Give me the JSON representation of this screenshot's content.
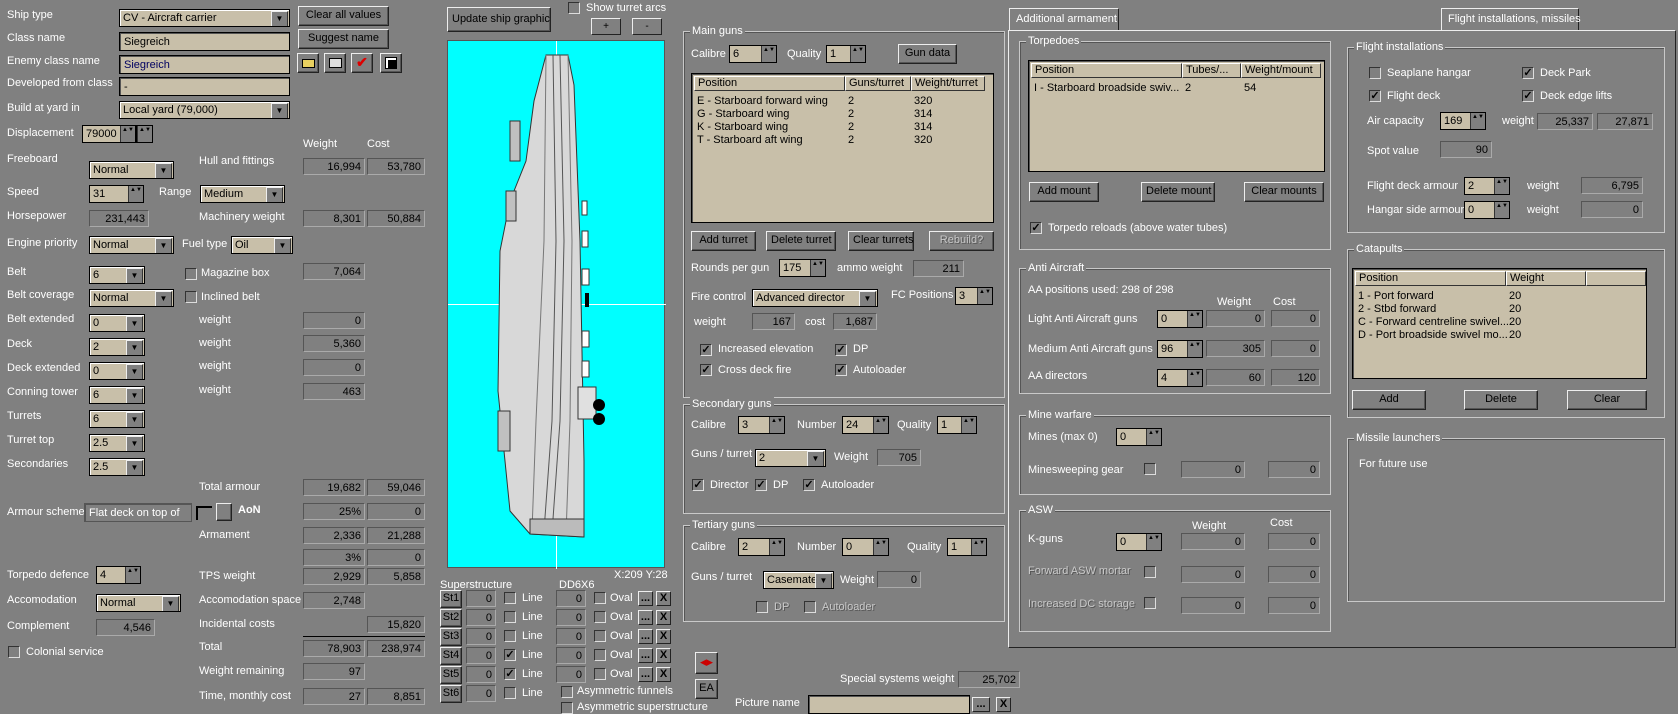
{
  "left": {
    "ship_type_label": "Ship type",
    "ship_type": "CV - Aircraft carrier",
    "class_name_label": "Class name",
    "class_name": "Siegreich",
    "enemy_class_label": "Enemy class name",
    "enemy_class": "Siegreich",
    "developed_label": "Developed from class",
    "developed": "-",
    "build_yard_label": "Build at yard in",
    "build_yard": "Local yard (79,000)",
    "clear_all": "Clear all values",
    "suggest_name": "Suggest name",
    "displacement_label": "Displacement",
    "displacement": "79000",
    "weight_header": "Weight",
    "cost_header": "Cost",
    "freeboard_label": "Freeboard",
    "freeboard": "Normal",
    "hull_label": "Hull and fittings",
    "hull_weight": "16,994",
    "hull_cost": "53,780",
    "speed_label": "Speed",
    "speed": "31",
    "range_label": "Range",
    "range": "Medium",
    "horsepower_label": "Horsepower",
    "horsepower": "231,443",
    "machinery_label": "Machinery weight",
    "machinery_weight": "8,301",
    "machinery_cost": "50,884",
    "engine_label": "Engine priority",
    "engine": "Normal",
    "fuel_label": "Fuel type",
    "fuel": "Oil",
    "belt_label": "Belt",
    "belt": "6",
    "magazine_box": "Magazine box",
    "magazine_weight": "7,064",
    "belt_cov_label": "Belt coverage",
    "belt_cov": "Normal",
    "inclined_belt": "Inclined belt",
    "belt_ext_label": "Belt extended",
    "belt_ext": "0",
    "deck_label": "Deck",
    "deck": "2",
    "deck_ext_label": "Deck extended",
    "deck_ext": "0",
    "conning_label": "Conning tower",
    "conning": "6",
    "weight_word": "weight",
    "w_belt_ext": "0",
    "w_deck": "5,360",
    "w_deck_ext": "0",
    "w_conning": "463",
    "turrets_label": "Turrets",
    "turrets": "6",
    "turret_top_label": "Turret top",
    "turret_top": "2.5",
    "secondaries_label": "Secondaries",
    "secondaries": "2.5",
    "total_armour_label": "Total armour",
    "total_armour_weight": "19,682",
    "total_armour_cost": "59,046",
    "armour_scheme_label": "Armour scheme",
    "armour_scheme": "Flat deck on top of",
    "aon": "AoN",
    "pct1": "25%",
    "pct1_cost": "0",
    "armament_label": "Armament",
    "armament_weight": "2,336",
    "armament_cost": "21,288",
    "pct2": "3%",
    "pct2_cost": "0",
    "torpedo_def_label": "Torpedo defence",
    "torpedo_def": "4",
    "tps_label": "TPS weight",
    "tps_weight": "2,929",
    "tps_cost": "5,858",
    "accom_label": "Accomodation",
    "accom": "Normal",
    "accom_space_label": "Accomodation space",
    "accom_space": "2,748",
    "complement_label": "Complement",
    "complement": "4,546",
    "incidental_label": "Incidental costs",
    "incidental": "15,820",
    "colonial": "Colonial service",
    "total_label": "Total",
    "total_weight": "78,903",
    "total_cost": "238,974",
    "weight_remaining_label": "Weight remaining",
    "weight_remaining": "97",
    "time_label": "Time, monthly cost",
    "time": "27",
    "monthly_cost": "8,851"
  },
  "center": {
    "update_graphic": "Update ship graphic",
    "show_arcs": "Show turret arcs",
    "plus": "+",
    "minus": "-",
    "coords": "X:209 Y:28",
    "superstructure_label": "Superstructure",
    "dd_label": "DD6X6",
    "st_rows": [
      {
        "btn": "St1",
        "val": "0",
        "line": "Line",
        "line_checked": false,
        "dd": "0",
        "oval": "Oval"
      },
      {
        "btn": "St2",
        "val": "0",
        "line": "Line",
        "line_checked": false,
        "dd": "0",
        "oval": "Oval"
      },
      {
        "btn": "St3",
        "val": "0",
        "line": "Line",
        "line_checked": false,
        "dd": "0",
        "oval": "Oval"
      },
      {
        "btn": "St4",
        "val": "0",
        "line": "Line",
        "line_checked": true,
        "dd": "0",
        "oval": "Oval"
      },
      {
        "btn": "St5",
        "val": "0",
        "line": "Line",
        "line_checked": true,
        "dd": "0",
        "oval": "Oval"
      },
      {
        "btn": "St6",
        "val": "0",
        "line": "Line",
        "line_checked": false
      }
    ],
    "dots": "...",
    "x": "X",
    "asym_funnels": "Asymmetric funnels",
    "asym_super": "Asymmetric superstructure",
    "ea": "EA",
    "picture_name_label": "Picture name",
    "special_label": "Special systems weight",
    "special_weight": "25,702"
  },
  "main_guns": {
    "title": "Main guns",
    "calibre_label": "Calibre",
    "calibre": "6",
    "quality_label": "Quality",
    "quality": "1",
    "gun_data": "Gun data",
    "headers": [
      "Position",
      "Guns/turret",
      "Weight/turret"
    ],
    "rows": [
      {
        "pos": "E - Starboard forward wing",
        "guns": "2",
        "weight": "320"
      },
      {
        "pos": "G - Starboard wing",
        "guns": "2",
        "weight": "314"
      },
      {
        "pos": "K - Starboard wing",
        "guns": "2",
        "weight": "314"
      },
      {
        "pos": "T - Starboard aft wing",
        "guns": "2",
        "weight": "320"
      }
    ],
    "add_turret": "Add turret",
    "delete_turret": "Delete turret",
    "clear_turrets": "Clear turrets",
    "rebuild": "Rebuild?",
    "rounds_label": "Rounds per gun",
    "rounds": "175",
    "ammo_label": "ammo weight",
    "ammo": "211",
    "fire_control_label": "Fire control",
    "fire_control": "Advanced director",
    "fc_pos_label": "FC Positions",
    "fc_pos": "3",
    "weight_label": "weight",
    "weight": "167",
    "cost_label": "cost",
    "cost": "1,687",
    "inc_elev": "Increased elevation",
    "dp": "DP",
    "cross_deck": "Cross deck fire",
    "autoloader": "Autoloader"
  },
  "secondary": {
    "title": "Secondary guns",
    "calibre_label": "Calibre",
    "calibre": "3",
    "number_label": "Number",
    "number": "24",
    "quality_label": "Quality",
    "quality": "1",
    "guns_turret_label": "Guns / turret",
    "guns_turret": "2",
    "weight_label": "Weight",
    "weight": "705",
    "director": "Director",
    "dp": "DP",
    "autoloader": "Autoloader"
  },
  "tertiary": {
    "title": "Tertiary guns",
    "calibre_label": "Calibre",
    "calibre": "2",
    "number_label": "Number",
    "number": "0",
    "quality_label": "Quality",
    "quality": "1",
    "guns_turret_label": "Guns / turret",
    "guns_turret": "Casemate",
    "weight_label": "Weight",
    "weight": "0",
    "dp": "DP",
    "autoloader": "Autoloader"
  },
  "tabs": {
    "additional": "Additional armament",
    "flight": "Flight installations, missiles"
  },
  "torpedoes": {
    "title": "Torpedoes",
    "headers": [
      "Position",
      "Tubes/...",
      "Weight/mount"
    ],
    "rows": [
      {
        "pos": "I - Starboard broadside swiv...",
        "tubes": "2",
        "weight": "54"
      }
    ],
    "add": "Add mount",
    "delete": "Delete mount",
    "clear": "Clear mounts",
    "reloads": "Torpedo reloads (above water tubes)"
  },
  "aa": {
    "title": "Anti Aircraft",
    "used": "AA positions used: 298 of 298",
    "weight_header": "Weight",
    "cost_header": "Cost",
    "light_label": "Light Anti Aircraft guns",
    "light": "0",
    "light_w": "0",
    "light_c": "0",
    "medium_label": "Medium Anti Aircraft guns",
    "medium": "96",
    "medium_w": "305",
    "medium_c": "0",
    "dir_label": "AA directors",
    "dir": "4",
    "dir_w": "60",
    "dir_c": "120"
  },
  "mine": {
    "title": "Mine warfare",
    "mines_label": "Mines (max 0)",
    "mines": "0",
    "sweep_label": "Minesweeping gear",
    "sweep_w": "0",
    "sweep_c": "0"
  },
  "asw": {
    "title": "ASW",
    "weight_header": "Weight",
    "cost_header": "Cost",
    "kguns_label": "K-guns",
    "kguns": "0",
    "kguns_w": "0",
    "kguns_c": "0",
    "mortar_label": "Forward ASW mortar",
    "mortar_w": "0",
    "mortar_c": "0",
    "dc_label": "Increased DC storage",
    "dc_w": "0",
    "dc_c": "0"
  },
  "flight": {
    "title": "Flight installations",
    "seaplane": "Seaplane hangar",
    "deck_park": "Deck Park",
    "flight_deck": "Flight deck",
    "edge_lifts": "Deck edge lifts",
    "air_cap_label": "Air capacity",
    "air_cap": "169",
    "weight_label": "weight",
    "air_weight": "25,337",
    "air_cost": "27,871",
    "spot_label": "Spot value",
    "spot": "90",
    "fd_armour_label": "Flight deck armour",
    "fd_armour": "2",
    "fd_weight": "6,795",
    "hangar_label": "Hangar side armour",
    "hangar": "0",
    "hangar_weight": "0"
  },
  "catapults": {
    "title": "Catapults",
    "headers": [
      "Position",
      "Weight"
    ],
    "rows": [
      {
        "pos": "1 - Port forward",
        "weight": "20"
      },
      {
        "pos": "2 - Stbd forward",
        "weight": "20"
      },
      {
        "pos": "C - Forward centreline swivel...",
        "weight": "20"
      },
      {
        "pos": "D - Port broadside swivel mo...",
        "weight": "20"
      }
    ],
    "add": "Add",
    "delete": "Delete",
    "clear": "Clear"
  },
  "missiles": {
    "title": "Missile launchers",
    "text": "For future  use"
  }
}
